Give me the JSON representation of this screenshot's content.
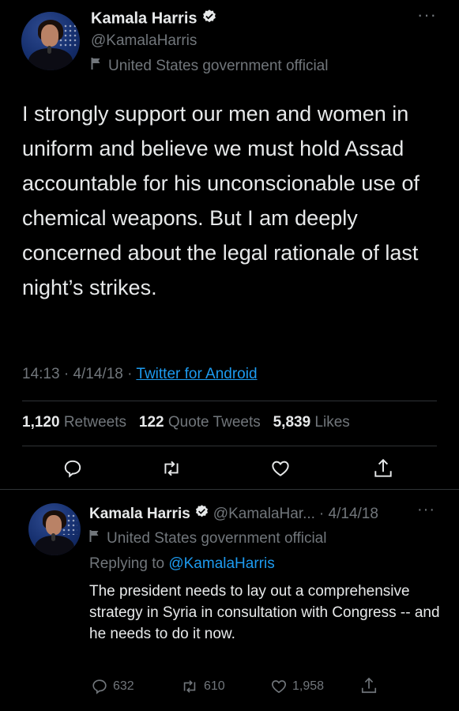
{
  "main_tweet": {
    "author_name": "Kamala Harris",
    "handle": "@KamalaHarris",
    "label": "United States government official",
    "text": "I strongly support our men and women in uniform and believe we must hold Assad accountable for his unconscionable use of chemical weapons. But I am deeply concerned about the legal rationale of last night’s strikes.",
    "time": "14:13",
    "date": "4/14/18",
    "source": "Twitter for Android",
    "sep": "·",
    "retweets": "1,120",
    "retweets_label": "Retweets",
    "quotes": "122",
    "quotes_label": "Quote Tweets",
    "likes": "5,839",
    "likes_label": "Likes",
    "more": "···"
  },
  "reply_tweet": {
    "author_name": "Kamala Harris",
    "handle": "@KamalaHar...",
    "date_part": "· 4/14/18",
    "label": "United States government official",
    "replying_prefix": "Replying to",
    "replying_handle": "@KamalaHarris",
    "text": "The president needs to lay out a comprehensive strategy in Syria in consultation with Congress -- and he needs to do it now.",
    "replies": "632",
    "retweets": "610",
    "likes": "1,958",
    "more": "···"
  },
  "icons": {
    "verified": "verified-badge-icon",
    "label_flag": "flag-icon",
    "reply": "reply-icon",
    "retweet": "retweet-icon",
    "like": "heart-icon",
    "share": "share-icon",
    "more": "more-icon"
  },
  "colors": {
    "background": "#000000",
    "text": "#e7e9ea",
    "muted": "#71767b",
    "accent": "#1d9bf0",
    "divider": "#2f3336"
  }
}
